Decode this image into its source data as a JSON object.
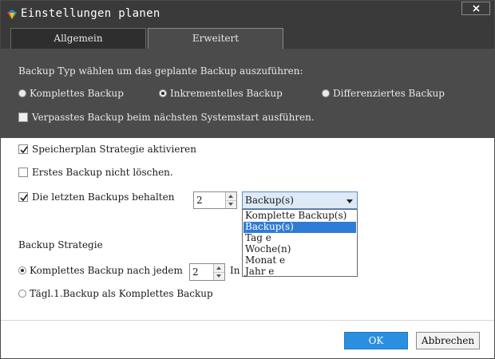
{
  "window": {
    "title": "Einstellungen planen"
  },
  "tabs": [
    {
      "label": "Allgemein"
    },
    {
      "label": "Erweitert"
    }
  ],
  "backup_type": {
    "prompt": "Backup Typ wählen um das geplante Backup auszuführen:",
    "options": [
      "Komplettes Backup",
      "Inkrementelles Backup",
      "Differenziertes Backup"
    ],
    "selected": "Inkrementelles Backup",
    "missed_backup_label": "Verpasstes Backup beim nächsten Systemstart ausführen.",
    "missed_backup_checked": false
  },
  "strategy": {
    "enable_label": "Speicherplan Strategie aktivieren",
    "enable_checked": true,
    "keep_first_label": "Erstes Backup nicht löschen.",
    "keep_first_checked": false,
    "keep_last_label": "Die letzten Backups behalten",
    "keep_last_checked": true,
    "keep_last_count": "2",
    "unit_selected": "Backup(s)",
    "unit_options": [
      "Komplette Backup(s)",
      "Backup(s)",
      "Tag e",
      "Woche(n)",
      "Monat e",
      "Jahr e"
    ],
    "section_title": "Backup Strategie",
    "full_every_label": "Komplettes Backup nach jedem",
    "full_every_count": "2",
    "full_every_suffix": "In",
    "daily_first_label": "Tägl.1.Backup als Komplettes Backup",
    "selected_strategy": "full_every"
  },
  "buttons": {
    "ok": "OK",
    "cancel": "Abbrechen"
  },
  "colors": {
    "titlebar": "#3a3a3a",
    "panel": "#4b4b4b",
    "accent": "#2a8fe0",
    "selection": "#2f7bd6"
  }
}
